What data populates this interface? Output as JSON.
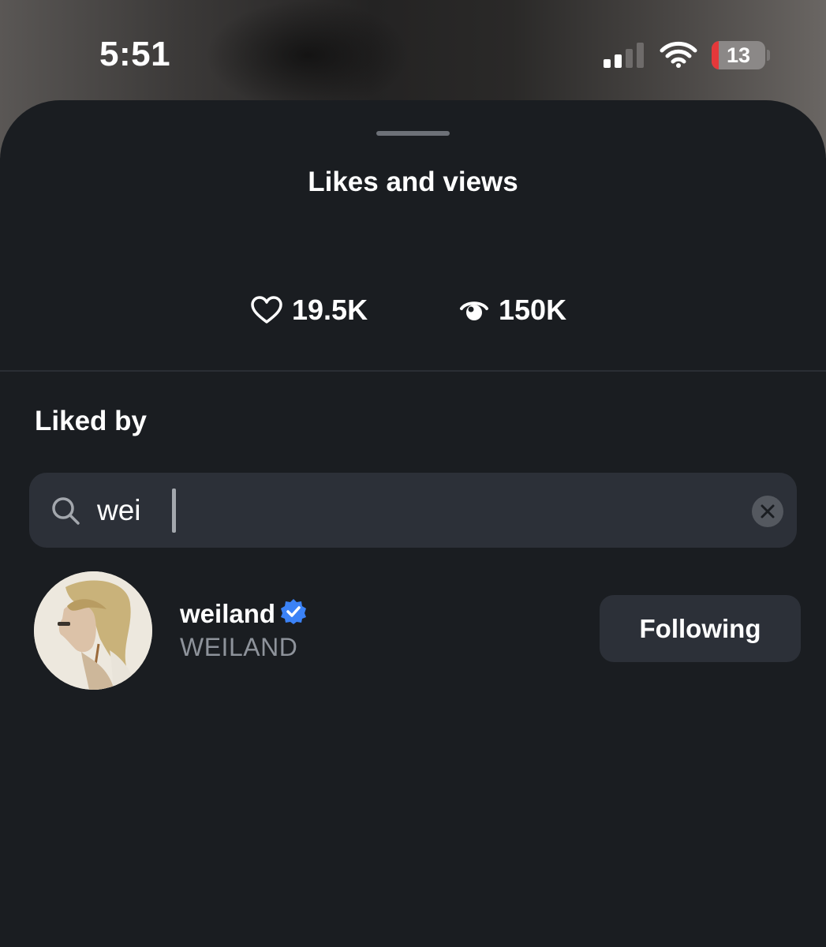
{
  "status_bar": {
    "time": "5:51",
    "battery_level": "13"
  },
  "sheet": {
    "title": "Likes and views"
  },
  "stats": {
    "likes": "19.5K",
    "views": "150K"
  },
  "liked_by": {
    "title": "Liked by",
    "search": {
      "value": "wei",
      "placeholder": ""
    },
    "users": [
      {
        "username": "weiland",
        "display_name": "WEILAND",
        "verified": true,
        "action_label": "Following"
      }
    ]
  },
  "colors": {
    "sheet_background": "#1a1d21",
    "surface": "#2c3038",
    "verified_badge": "#3b82f6",
    "battery_low": "#e5383a",
    "secondary_text": "#8e939b"
  }
}
